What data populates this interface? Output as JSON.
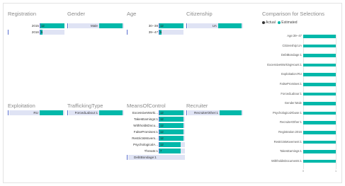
{
  "colors": {
    "bar": "#01b8aa",
    "selection": "#dfe3f4",
    "selection_edge": "#5a6fcf",
    "title": "#8a8a8a",
    "actual_dot": "#333333"
  },
  "panels": {
    "registration": {
      "title": "Registration",
      "rows": [
        {
          "label": "2015",
          "value": "12"
        },
        {
          "label": "2016",
          "value": "5"
        }
      ]
    },
    "gender": {
      "title": "Gender",
      "rows": [
        {
          "label": "Male",
          "value": ""
        }
      ]
    },
    "age": {
      "title": "Age",
      "rows": [
        {
          "label": "30--38",
          "value": "12"
        },
        {
          "label": "39--47",
          "value": "5"
        }
      ]
    },
    "citizenship": {
      "title": "Citizenship",
      "rows": [
        {
          "label": "UA",
          "value": ""
        }
      ]
    },
    "exploitation": {
      "title": "Exploitation",
      "rows": [
        {
          "label": "RU",
          "value": ""
        }
      ]
    },
    "trafficking": {
      "title": "TraffickingType",
      "rows": [
        {
          "label": "ForcedLabour:1",
          "value": ""
        }
      ]
    },
    "means": {
      "title": "MeansOfControl",
      "rows": [
        {
          "label": "ExcessiveWorki...",
          "value": "12"
        },
        {
          "label": "TakesEarnings:1",
          "value": "12"
        },
        {
          "label": "WithholdsDocu...",
          "value": "12"
        },
        {
          "label": "FalsePromises:1",
          "value": "12"
        },
        {
          "label": "RestrictsMovem...",
          "value": "12"
        },
        {
          "label": "PsychologicalA...",
          "value": "12"
        },
        {
          "label": "Threats:1",
          "value": "7"
        },
        {
          "label": "DebtBondage:1",
          "value": ""
        }
      ]
    },
    "recruiter": {
      "title": "Recruiter",
      "rows": [
        {
          "label": "RecruiterOther:1",
          "value": ""
        }
      ]
    }
  },
  "comparison": {
    "title": "Comparison for Selections",
    "legend": {
      "actual": "Actual",
      "estimated": "Estimated"
    },
    "rows": [
      "Age:39--47",
      "Citizenship:UA",
      "DebtBondage:1",
      "ExcessiveWorkingHours:1",
      "Exploitation:RU",
      "FalsePromises:1",
      "ForcedLabour:1",
      "Gender:Male",
      "PsychologicalAbuse:1",
      "RecruiterOther:1",
      "Registration:2016",
      "RestrictsMovement:1",
      "TakesEarnings:1",
      "WithholdsDocuments:1"
    ],
    "values": [
      1,
      1,
      1,
      1,
      1,
      1,
      1,
      1,
      1,
      1,
      1,
      1,
      1,
      1
    ],
    "ticks": [
      "0",
      "1"
    ]
  }
}
